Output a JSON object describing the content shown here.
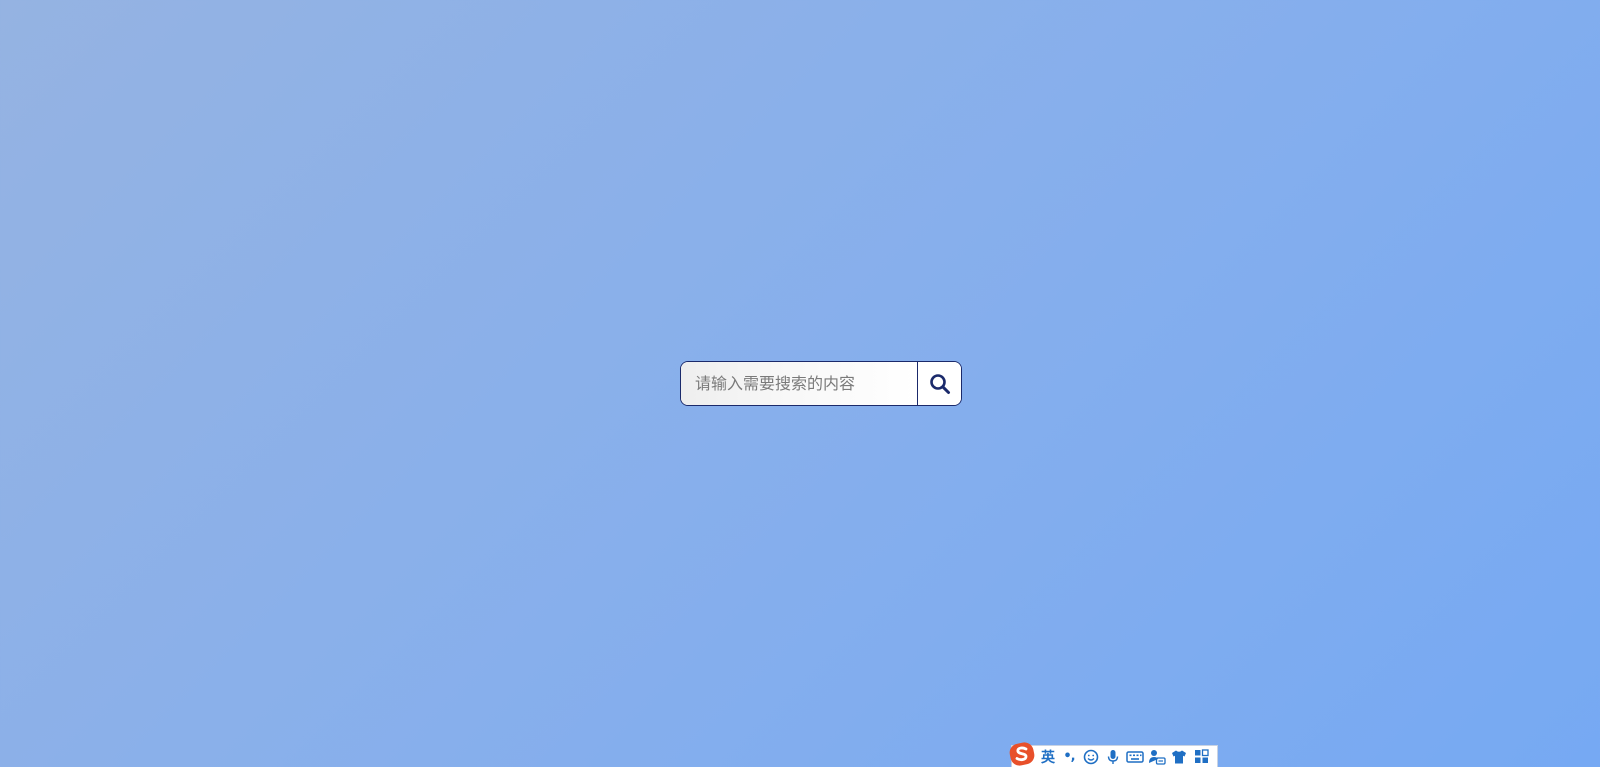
{
  "search": {
    "placeholder": "请输入需要搜索的内容",
    "value": "",
    "button_icon": "search-icon"
  },
  "ime_toolbar": {
    "logo_icon": "sogou-logo-icon",
    "language_label": "英",
    "punctuation_label": "•,",
    "items": [
      "punctuation-icon",
      "emoji-icon",
      "microphone-icon",
      "keyboard-icon",
      "user-voice-icon",
      "skin-shirt-icon",
      "toolbox-grid-icon"
    ]
  },
  "colors": {
    "background_start": "#95b3e2",
    "background_end": "#76a9f3",
    "search_border": "#1b2a6b",
    "ime_accent": "#1f6fc4",
    "sogou_logo": "#e8502a"
  }
}
